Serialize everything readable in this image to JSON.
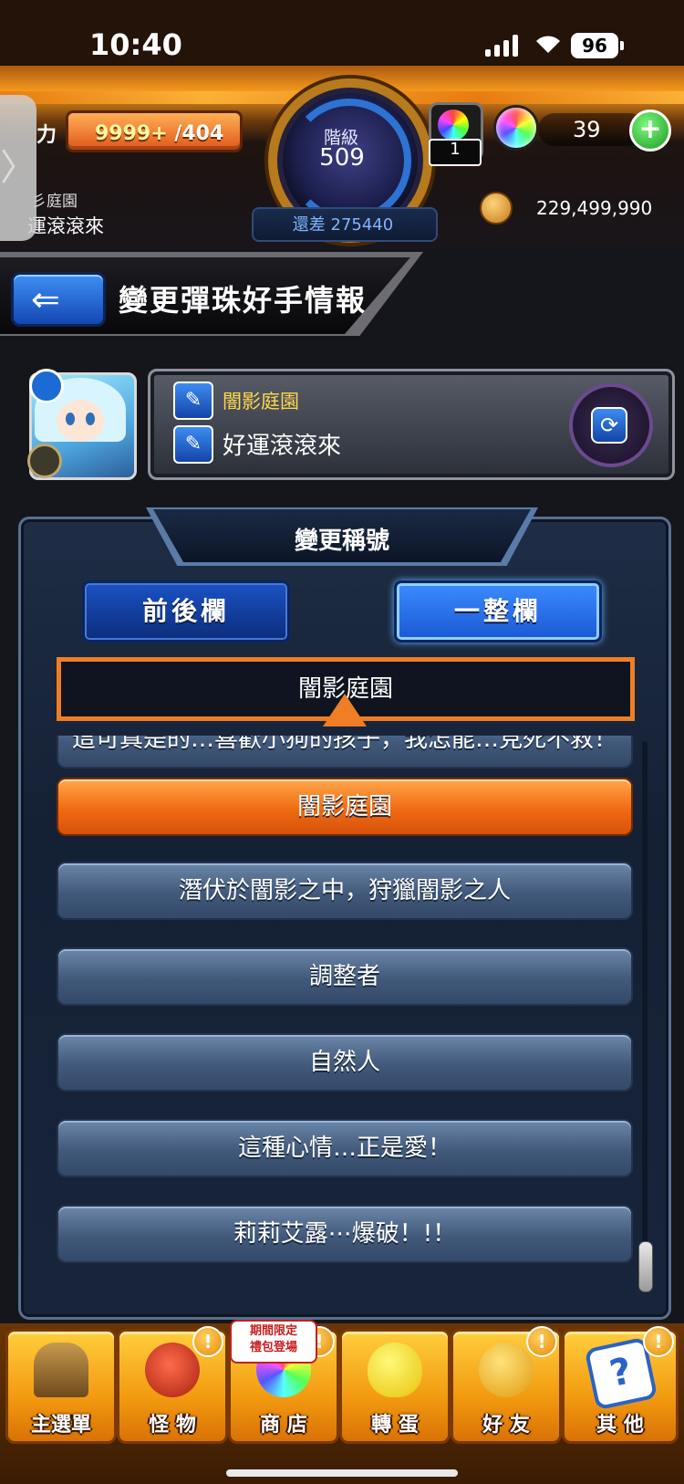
{
  "status_bar": {
    "time": "10:40",
    "battery": "96"
  },
  "hud": {
    "stamina_label": "力",
    "stamina_current": "9999+",
    "stamina_max": "/404",
    "player_title_partial": "彡庭園",
    "player_name_partial": "運滾滾來",
    "rank_label": "階級",
    "rank_value": "509",
    "rank_remaining": "還差 275440",
    "orb_item_count": "1",
    "gem_count": "39",
    "coin_count": "229,499,990"
  },
  "header": {
    "title": "變更彈珠好手情報"
  },
  "profile": {
    "title": "闇影庭園",
    "name": "好運滾滾來"
  },
  "panel": {
    "title": "變更稱號",
    "mode_front_back": "前後欄",
    "mode_full_row": "一整欄",
    "preview_title": "闇影庭園",
    "titles": [
      "這可真是的…喜歡小狗的孩子，我怎能…見死不救！",
      "闇影庭園",
      "潛伏於闇影之中，狩獵闇影之人",
      "調整者",
      "自然人",
      "這種心情…正是愛！",
      "莉莉艾露⋯爆破！!！"
    ],
    "selected_index": 1
  },
  "bottom_nav": {
    "items": [
      {
        "label": "主選單",
        "icon": "home-gate-icon"
      },
      {
        "label": "怪 物",
        "icon": "monster-icon"
      },
      {
        "label": "商 店",
        "icon": "shop-orb-icon"
      },
      {
        "label": "轉 蛋",
        "icon": "gacha-egg-icon"
      },
      {
        "label": "好 友",
        "icon": "friends-icon"
      },
      {
        "label": "其 他",
        "icon": "question-icon"
      }
    ],
    "shop_badge_line1": "期間限定",
    "shop_badge_line2": "禮包登場",
    "alert": "!"
  },
  "colors": {
    "accent_orange": "#f07e24",
    "selected_row": "#f06a12",
    "row_blue": "#41597a",
    "nav_gold": "#f29a10"
  }
}
